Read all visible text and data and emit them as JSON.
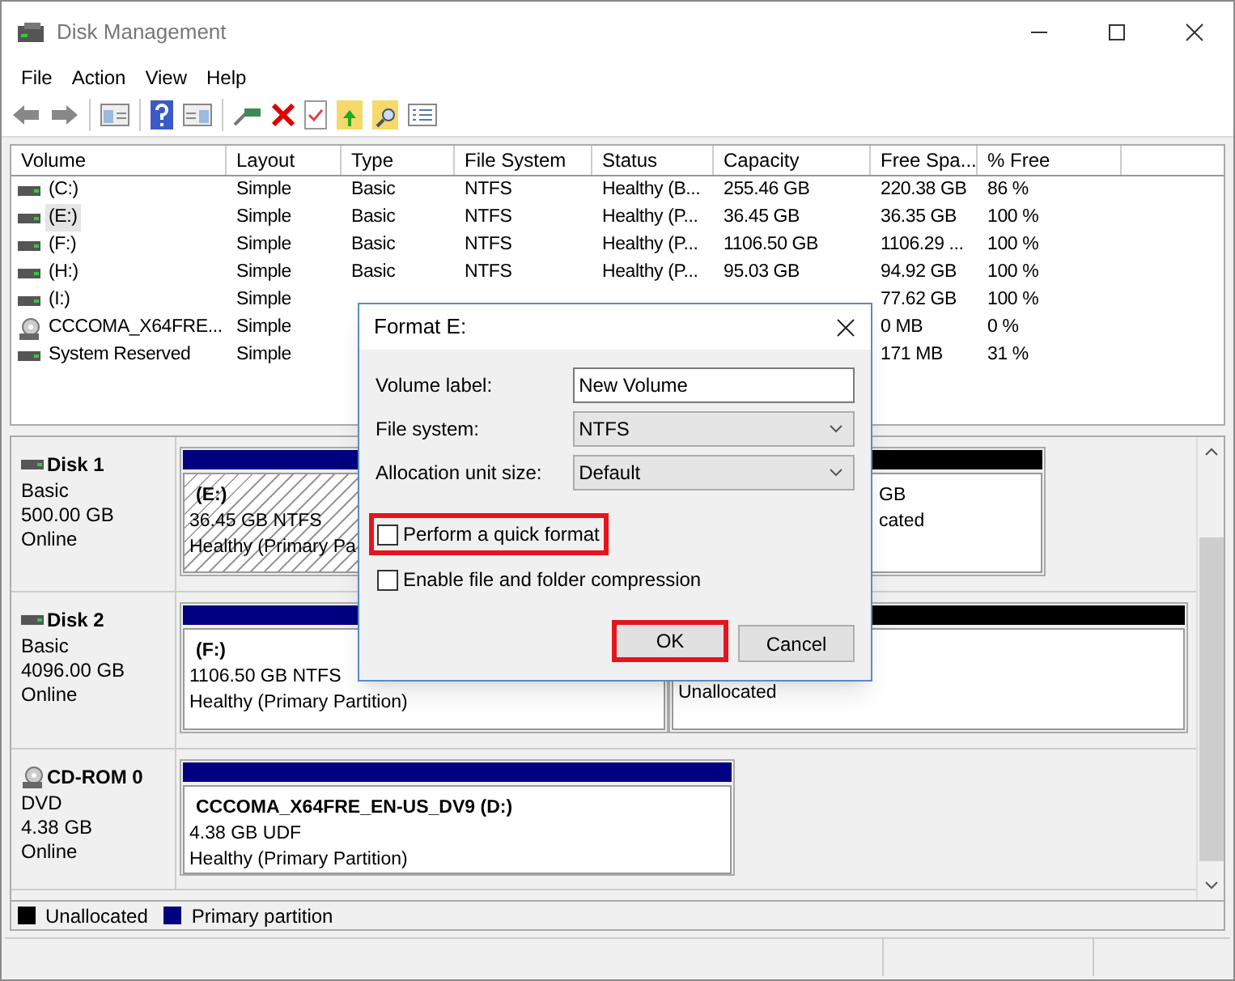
{
  "window": {
    "title": "Disk Management"
  },
  "menu": [
    "File",
    "Action",
    "View",
    "Help"
  ],
  "table": {
    "columns": [
      "Volume",
      "Layout",
      "Type",
      "File System",
      "Status",
      "Capacity",
      "Free Spa...",
      "% Free"
    ],
    "rows": [
      {
        "kind": "disk",
        "selected": false,
        "cells": {
          "volume": "(C:)",
          "layout": "Simple",
          "type": "Basic",
          "file_system": "NTFS",
          "status": "Healthy (B...",
          "capacity": "255.46 GB",
          "free_space": "220.38 GB",
          "percent_free": "86 %"
        }
      },
      {
        "kind": "disk",
        "selected": true,
        "cells": {
          "volume": "(E:)",
          "layout": "Simple",
          "type": "Basic",
          "file_system": "NTFS",
          "status": "Healthy (P...",
          "capacity": "36.45 GB",
          "free_space": "36.35 GB",
          "percent_free": "100 %"
        }
      },
      {
        "kind": "disk",
        "selected": false,
        "cells": {
          "volume": "(F:)",
          "layout": "Simple",
          "type": "Basic",
          "file_system": "NTFS",
          "status": "Healthy (P...",
          "capacity": "1106.50 GB",
          "free_space": "1106.29 ...",
          "percent_free": "100 %"
        }
      },
      {
        "kind": "disk",
        "selected": false,
        "cells": {
          "volume": "(H:)",
          "layout": "Simple",
          "type": "Basic",
          "file_system": "NTFS",
          "status": "Healthy (P...",
          "capacity": "95.03 GB",
          "free_space": "94.92 GB",
          "percent_free": "100 %"
        }
      },
      {
        "kind": "disk",
        "selected": false,
        "cells": {
          "volume": "(I:)",
          "layout": "Simple",
          "free_space": "77.62 GB",
          "percent_free": "100 %"
        }
      },
      {
        "kind": "cd",
        "selected": false,
        "cells": {
          "volume": "CCCOMA_X64FRE...",
          "layout": "Simple",
          "free_space": "0 MB",
          "percent_free": "0 %"
        }
      },
      {
        "kind": "disk",
        "selected": false,
        "cells": {
          "volume": "System Reserved",
          "layout": "Simple",
          "free_space": "171 MB",
          "percent_free": "31 %"
        }
      }
    ]
  },
  "disks": [
    {
      "kind": "disk",
      "name": "Disk 1",
      "type": "Basic",
      "size": "500.00 GB",
      "status": "Online",
      "partitions": [
        {
          "kind": "primary",
          "selected": true,
          "lines": [
            "(E:)",
            "36.45 GB NTFS",
            "Healthy (Primary Pa"
          ]
        },
        {
          "kind": "unallocated",
          "selected": false,
          "lines": [
            "GB",
            "cated"
          ]
        }
      ]
    },
    {
      "kind": "disk",
      "name": "Disk 2",
      "type": "Basic",
      "size": "4096.00 GB",
      "status": "Online",
      "partitions": [
        {
          "kind": "primary",
          "selected": false,
          "lines": [
            "(F:)",
            "1106.50 GB NTFS",
            "Healthy (Primary Partition)"
          ]
        },
        {
          "kind": "unallocated",
          "selected": false,
          "lines": [
            "Unallocated"
          ]
        }
      ]
    },
    {
      "kind": "cdrom",
      "name": "CD-ROM 0",
      "type": "DVD",
      "size": "4.38 GB",
      "status": "Online",
      "partitions": [
        {
          "kind": "primary",
          "selected": false,
          "lines": [
            "CCCOMA_X64FRE_EN-US_DV9  (D:)",
            "4.38 GB UDF",
            "Healthy (Primary Partition)"
          ]
        }
      ]
    }
  ],
  "legend": [
    {
      "label": "Unallocated",
      "color": "#000000"
    },
    {
      "label": "Primary partition",
      "color": "#000080"
    }
  ],
  "dialog": {
    "title": "Format E:",
    "fields": [
      {
        "kind": "text",
        "label": "Volume label:",
        "value": "New Volume"
      },
      {
        "kind": "select",
        "label": "File system:",
        "value": "NTFS"
      },
      {
        "kind": "select",
        "label": "Allocation unit size:",
        "value": "Default"
      }
    ],
    "checkboxes": [
      {
        "label": "Perform a quick format",
        "checked": false,
        "highlighted": true
      },
      {
        "label": "Enable file and folder compression",
        "checked": false,
        "highlighted": false
      }
    ],
    "buttons": [
      {
        "label": "OK",
        "highlighted": true
      },
      {
        "label": "Cancel",
        "highlighted": false
      }
    ]
  }
}
